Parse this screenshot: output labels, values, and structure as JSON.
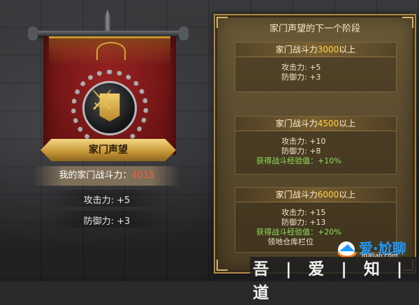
{
  "left": {
    "banner_title": "家门声望",
    "power_label": "我的家门战斗力：",
    "power_value": "4015",
    "stats": [
      "攻击力: +5",
      "防御力: +3"
    ]
  },
  "panel": {
    "title": "家门声望的下一个阶段",
    "tiers": [
      {
        "header_prefix": "家门战斗力",
        "header_value": "3000",
        "header_suffix": "以上",
        "lines": [
          {
            "text": "攻击力: +5",
            "color": "default"
          },
          {
            "text": "防御力: +3",
            "color": "default"
          }
        ]
      },
      {
        "header_prefix": "家门战斗力",
        "header_value": "4500",
        "header_suffix": "以上",
        "lines": [
          {
            "text": "攻击力: +10",
            "color": "default"
          },
          {
            "text": "防御力: +8",
            "color": "default"
          },
          {
            "text": "获得战斗经验值：+10%",
            "color": "green"
          }
        ]
      },
      {
        "header_prefix": "家门战斗力",
        "header_value": "6000",
        "header_suffix": "以上",
        "lines": [
          {
            "text": "攻击力: +15",
            "color": "default"
          },
          {
            "text": "防御力: +13",
            "color": "default"
          },
          {
            "text": "获得战斗经验值：+20%",
            "color": "green"
          },
          {
            "text": "领地仓库栏位",
            "color": "default"
          }
        ]
      }
    ]
  },
  "watermark": {
    "chars": "吾 | 爱 | 知 | 道",
    "brand": "爱·尬聊",
    "url": "igaliao.com"
  },
  "colors": {
    "accent_gold": "#ffd24a",
    "power_value": "#ff5a3a",
    "bonus_green": "#8fe05a",
    "panel_bg": "#5a4b2d",
    "banner_red": "#8b1b1b"
  }
}
